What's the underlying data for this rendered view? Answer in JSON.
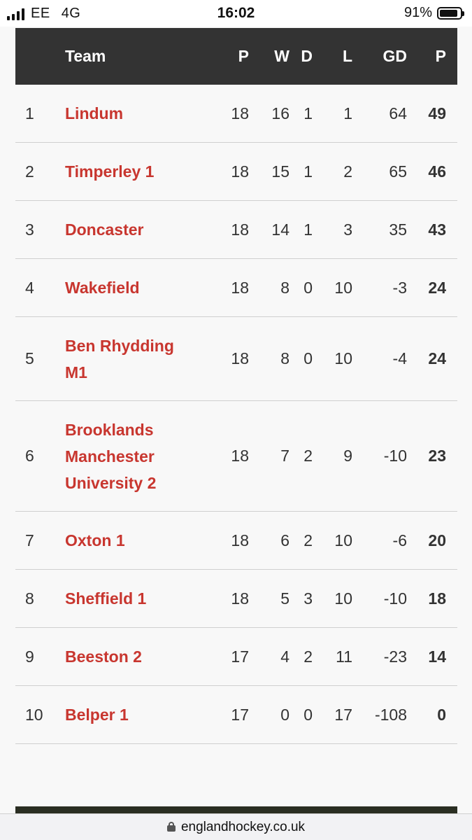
{
  "status_bar": {
    "carrier": "EE",
    "network": "4G",
    "time": "16:02",
    "battery": "91%",
    "battery_level": 0.91
  },
  "table": {
    "headers": {
      "position": "",
      "team": "Team",
      "played": "P",
      "won": "W",
      "drawn": "D",
      "lost": "L",
      "goal_difference": "GD",
      "points": "P"
    },
    "rows": [
      {
        "pos": "1",
        "team": "Lindum",
        "p": "18",
        "w": "16",
        "d": "1",
        "l": "1",
        "gd": "64",
        "pts": "49"
      },
      {
        "pos": "2",
        "team": "Timperley 1",
        "p": "18",
        "w": "15",
        "d": "1",
        "l": "2",
        "gd": "65",
        "pts": "46"
      },
      {
        "pos": "3",
        "team": "Doncaster",
        "p": "18",
        "w": "14",
        "d": "1",
        "l": "3",
        "gd": "35",
        "pts": "43"
      },
      {
        "pos": "4",
        "team": "Wakefield",
        "p": "18",
        "w": "8",
        "d": "0",
        "l": "10",
        "gd": "-3",
        "pts": "24"
      },
      {
        "pos": "5",
        "team": "Ben Rhydding M1",
        "p": "18",
        "w": "8",
        "d": "0",
        "l": "10",
        "gd": "-4",
        "pts": "24"
      },
      {
        "pos": "6",
        "team": "Brooklands Manchester University 2",
        "p": "18",
        "w": "7",
        "d": "2",
        "l": "9",
        "gd": "-10",
        "pts": "23"
      },
      {
        "pos": "7",
        "team": "Oxton 1",
        "p": "18",
        "w": "6",
        "d": "2",
        "l": "10",
        "gd": "-6",
        "pts": "20"
      },
      {
        "pos": "8",
        "team": "Sheffield 1",
        "p": "18",
        "w": "5",
        "d": "3",
        "l": "10",
        "gd": "-10",
        "pts": "18"
      },
      {
        "pos": "9",
        "team": "Beeston 2",
        "p": "17",
        "w": "4",
        "d": "2",
        "l": "11",
        "gd": "-23",
        "pts": "14"
      },
      {
        "pos": "10",
        "team": "Belper 1",
        "p": "17",
        "w": "0",
        "d": "0",
        "l": "17",
        "gd": "-108",
        "pts": "0"
      }
    ]
  },
  "url_bar": {
    "domain": "englandhockey.co.uk",
    "icon": "lock-icon"
  },
  "colors": {
    "header_bg": "#333333",
    "team_link": "#c8362f",
    "page_bg": "#f8f8f8"
  }
}
